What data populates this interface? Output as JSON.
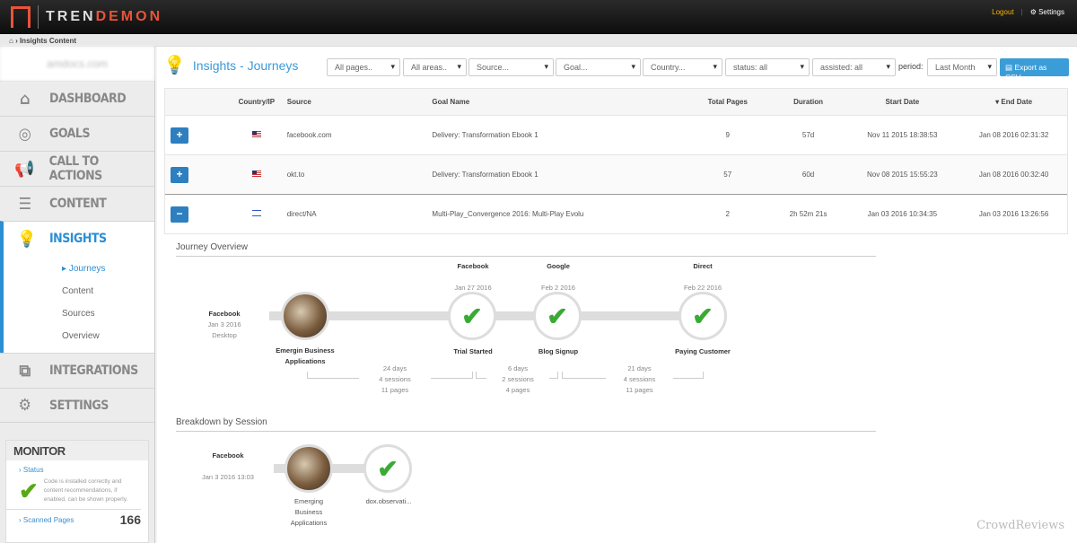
{
  "header": {
    "logo_text_1": "TREN",
    "logo_text_2": "DEMON",
    "logout": "Logout",
    "settings": "Settings"
  },
  "breadcrumb": {
    "home_icon": "home-icon",
    "current": "Insights Content"
  },
  "sidebar": {
    "account": "amdocs.com",
    "items": [
      {
        "label": "DASHBOARD",
        "icon": "⌂"
      },
      {
        "label": "GOALS",
        "icon": "◎"
      },
      {
        "label": "CALL TO ACTIONS",
        "icon": "📢"
      },
      {
        "label": "CONTENT",
        "icon": "☰"
      },
      {
        "label": "INSIGHTS",
        "icon": "💡"
      },
      {
        "label": "INTEGRATIONS",
        "icon": "⧉"
      },
      {
        "label": "SETTINGS",
        "icon": "⚙"
      }
    ],
    "sub_items": [
      "Journeys",
      "Content",
      "Sources",
      "Overview"
    ],
    "monitor": {
      "title": "MONITOR",
      "status_label": "Status",
      "status_text": "Code is installed correctly and content recommendations, if enabled, can be shown properly.",
      "scanned_label": "Scanned Pages",
      "scanned_count": "166"
    }
  },
  "page": {
    "title": "Insights - Journeys"
  },
  "filters": {
    "pages": "All pages..",
    "areas": "All areas..",
    "source": "Source...",
    "goal": "Goal...",
    "country": "Country...",
    "status": "status: all",
    "assisted": "assisted: all",
    "period_label": "period:",
    "period": "Last Month",
    "export": "Export as CSV"
  },
  "table": {
    "headers": [
      "Country/IP",
      "Source",
      "Goal Name",
      "Total Pages",
      "Duration",
      "Start Date",
      "End Date"
    ],
    "rows": [
      {
        "toggle": "+",
        "source": "facebook.com",
        "goal": "Delivery: Transformation Ebook 1",
        "pages": "9",
        "duration": "57d",
        "start": "Nov 11 2015 18:38:53",
        "end": "Jan 08 2016 02:31:32"
      },
      {
        "toggle": "+",
        "source": "okt.to",
        "goal": "Delivery: Transformation Ebook 1",
        "pages": "57",
        "duration": "60d",
        "start": "Nov 08 2015 15:55:23",
        "end": "Jan 08 2016 00:32:40"
      },
      {
        "toggle": "−",
        "source": "direct/NA",
        "goal": "Multi-Play_Convergence 2016: Multi-Play Evolu",
        "pages": "2",
        "duration": "2h 52m 21s",
        "start": "Jan 03 2016 10:34:35",
        "end": "Jan 03 2016 13:26:56"
      }
    ]
  },
  "journey": {
    "title": "Journey Overview",
    "start": {
      "source": "Facebook",
      "date": "Jan 3 2016",
      "device": "Desktop"
    },
    "content": "Emergin Business Applications",
    "goals": [
      {
        "source": "Facebook",
        "date": "Jan 27 2016",
        "label": "Trial Started"
      },
      {
        "source": "Google",
        "date": "Feb 2 2016",
        "label": "Blog Signup"
      },
      {
        "source": "Direct",
        "date": "Feb 22 2016",
        "label": "Paying Customer"
      }
    ],
    "gaps": [
      {
        "days": "24 days",
        "sessions": "4 sessions",
        "pages": "11 pages"
      },
      {
        "days": "6 days",
        "sessions": "2 sessions",
        "pages": "4 pages"
      },
      {
        "days": "21 days",
        "sessions": "4 sessions",
        "pages": "11 pages"
      }
    ]
  },
  "breakdown": {
    "title": "Breakdown by Session",
    "source": "Facebook",
    "datetime": "Jan 3 2016 13:03",
    "content": "Emerging Business Applications",
    "page": "dox.observati..."
  },
  "watermark": "CrowdReviews"
}
